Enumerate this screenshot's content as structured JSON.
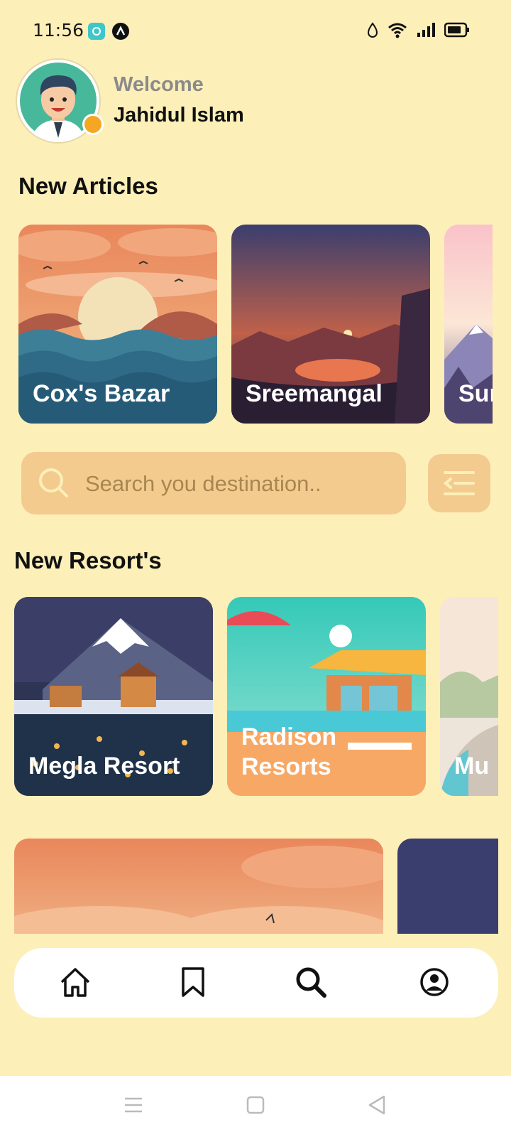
{
  "status_bar": {
    "time": "11:56"
  },
  "header": {
    "welcome": "Welcome",
    "username": "Jahidul Islam"
  },
  "articles": {
    "title": "New Articles",
    "items": [
      {
        "label": "Cox's Bazar"
      },
      {
        "label": "Sreemangal"
      },
      {
        "label": "Sur"
      }
    ]
  },
  "search": {
    "placeholder": "Search you destination.."
  },
  "resorts": {
    "title": "New Resort's",
    "items": [
      {
        "label": "Megla Resort"
      },
      {
        "label": "Radison Resorts"
      },
      {
        "label": "Mu"
      }
    ]
  },
  "bottom_nav": {
    "items": [
      "home-icon",
      "bookmark-icon",
      "search-icon",
      "profile-icon"
    ],
    "active": "search-icon"
  },
  "colors": {
    "background": "#FDEFB8",
    "search_bg": "#F3CB8F",
    "online": "#F5A623"
  }
}
